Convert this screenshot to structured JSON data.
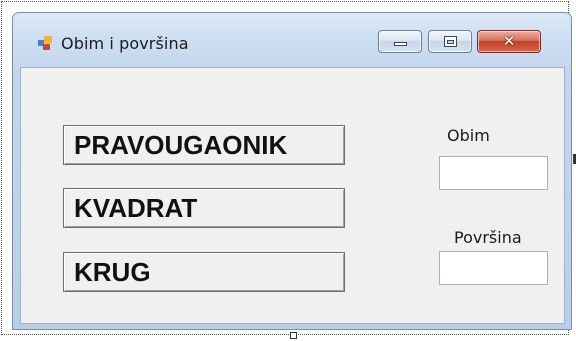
{
  "window": {
    "title": "Obim i površina",
    "icon": "form-icon",
    "controls": {
      "minimize": "minimize-icon",
      "maximize": "maximize-icon",
      "close": "close-icon",
      "close_glyph": "✕"
    },
    "accent_color": "#c2402a"
  },
  "buttons": [
    {
      "label": "PRAVOUGAONIK"
    },
    {
      "label": "KVADRAT"
    },
    {
      "label": "KRUG"
    }
  ],
  "fields": {
    "obim": {
      "label": "Obim",
      "value": ""
    },
    "povrsina": {
      "label": "Površina",
      "value": ""
    }
  }
}
